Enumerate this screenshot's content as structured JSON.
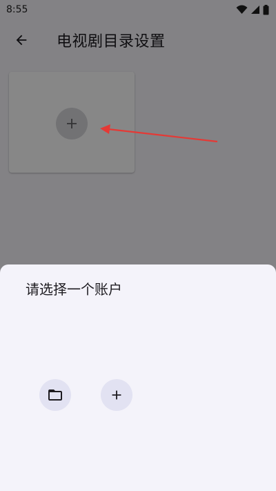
{
  "status_bar": {
    "time": "8:55",
    "icons": [
      "wifi-icon",
      "signal-icon",
      "battery-icon"
    ]
  },
  "app_bar": {
    "back_icon": "arrow-back-icon",
    "title": "电视剧目录设置"
  },
  "main": {
    "card": {
      "add_icon": "plus-icon"
    }
  },
  "annotation": {
    "type": "arrow",
    "color": "#e53935"
  },
  "bottom_sheet": {
    "title": "请选择一个账户",
    "buttons": [
      {
        "icon": "folder-icon"
      },
      {
        "icon": "plus-icon"
      }
    ]
  },
  "colors": {
    "scrim": "#000000",
    "sheet_background": "#f4f3fa",
    "sheet_button_background": "#e2e2f2"
  }
}
